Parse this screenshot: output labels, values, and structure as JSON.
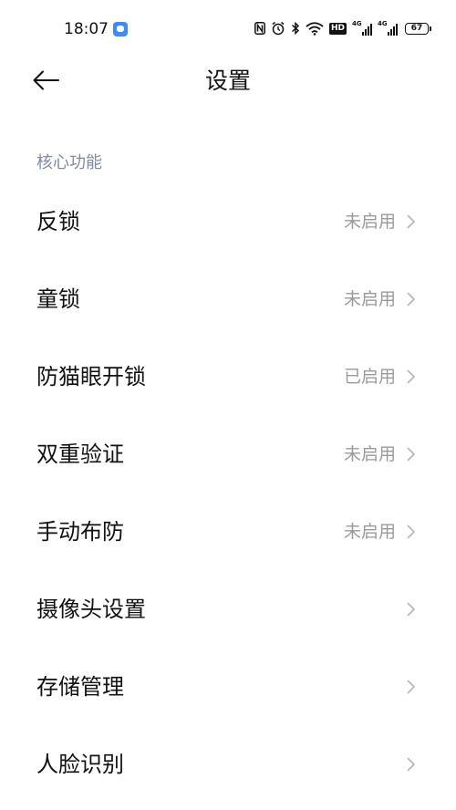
{
  "status_bar": {
    "time": "18:07",
    "network_badge": "HD",
    "signal1_label": "4G",
    "signal2_label": "4G",
    "battery_level": "67",
    "icons": [
      "nfc-icon",
      "alarm-icon",
      "bluetooth-icon",
      "wifi-icon",
      "hd-icon",
      "signal-icon",
      "signal-icon",
      "battery-icon"
    ]
  },
  "header": {
    "title": "设置",
    "back_icon": "back-arrow-icon"
  },
  "section": {
    "title": "核心功能"
  },
  "items": [
    {
      "label": "反锁",
      "status": "未启用"
    },
    {
      "label": "童锁",
      "status": "未启用"
    },
    {
      "label": "防猫眼开锁",
      "status": "已启用"
    },
    {
      "label": "双重验证",
      "status": "未启用"
    },
    {
      "label": "手动布防",
      "status": "未启用"
    },
    {
      "label": "摄像头设置",
      "status": ""
    },
    {
      "label": "存储管理",
      "status": ""
    },
    {
      "label": "人脸识别",
      "status": ""
    }
  ],
  "colors": {
    "background": "#ffffff",
    "text": "#111111",
    "section_title": "#7f8aa0",
    "status_text": "#9a9a9a",
    "chevron": "#b5b5b5",
    "notification_app": "#3b8cf4"
  }
}
